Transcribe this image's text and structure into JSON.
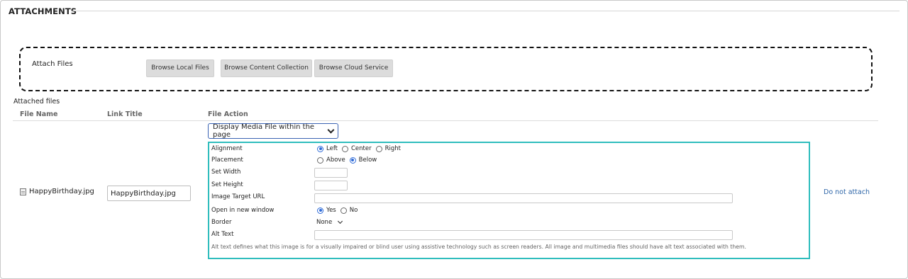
{
  "section": {
    "title": "ATTACHMENTS"
  },
  "attach": {
    "label": "Attach Files",
    "buttons": [
      "Browse Local Files",
      "Browse Content Collection",
      "Browse Cloud Service"
    ]
  },
  "attached": {
    "label": "Attached files",
    "columns": [
      "File Name",
      "Link Title",
      "File Action"
    ],
    "row": {
      "file_name": "HappyBirthday.jpg",
      "link_title": "HappyBirthday.jpg",
      "file_action": "Display Media File within the page",
      "remove_label": "Do not attach"
    }
  },
  "options": {
    "alignment": {
      "label": "Alignment",
      "choices": [
        "Left",
        "Center",
        "Right"
      ],
      "selected": "Left"
    },
    "placement": {
      "label": "Placement",
      "choices": [
        "Above",
        "Below"
      ],
      "selected": "Below"
    },
    "set_width": {
      "label": "Set Width",
      "value": ""
    },
    "set_height": {
      "label": "Set Height",
      "value": ""
    },
    "target_url": {
      "label": "Image Target URL",
      "value": ""
    },
    "new_window": {
      "label": "Open in new window",
      "choices": [
        "Yes",
        "No"
      ],
      "selected": "Yes"
    },
    "border": {
      "label": "Border",
      "value": "None"
    },
    "alt_text": {
      "label": "Alt Text",
      "value": ""
    },
    "help": "Alt text defines what this image is for a visually impaired or blind user using assistive technology such as screen readers. All image and multimedia files should have alt text associated with them."
  },
  "colors": {
    "accent": "#2fbdbd",
    "link": "#2e66a8",
    "radio": "#2f6bd8"
  },
  "icons": {
    "file": "file-icon",
    "dropdown": "chevron-down-icon"
  }
}
